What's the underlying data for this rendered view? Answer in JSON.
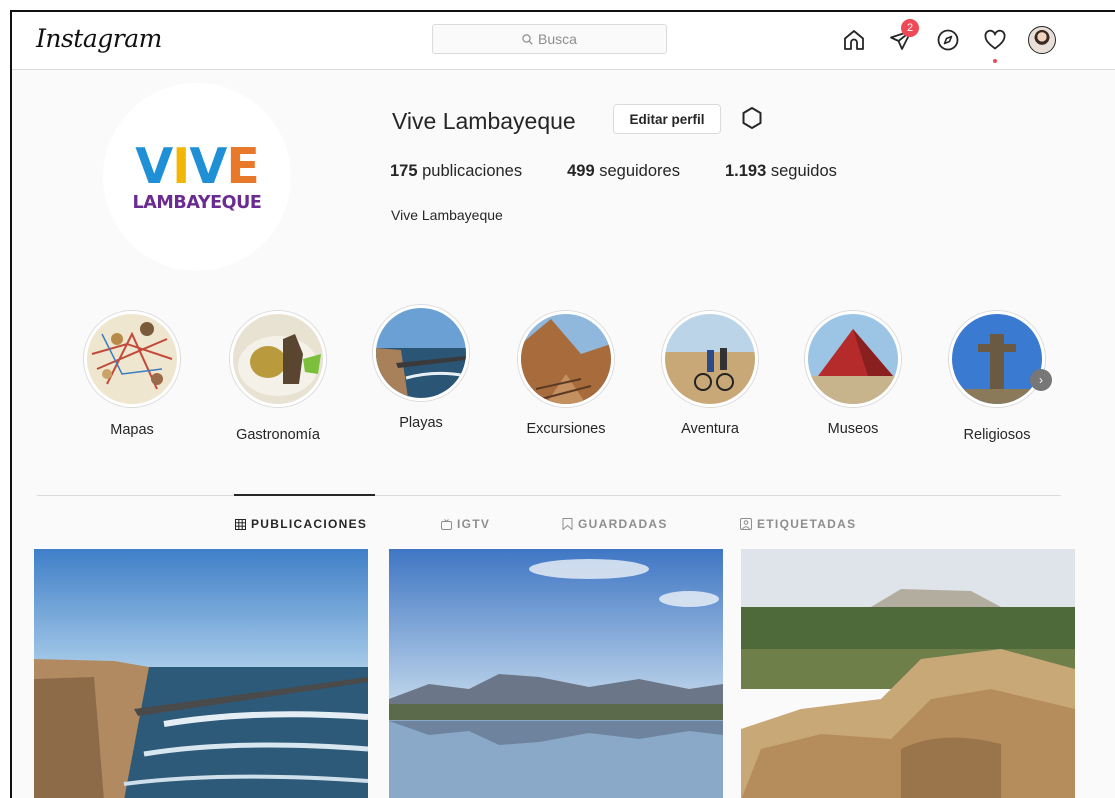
{
  "nav": {
    "logo": "Instagram",
    "search_placeholder": "Busca",
    "direct_badge": "2",
    "icons": [
      "home-icon",
      "direct-icon",
      "explore-icon",
      "activity-heart-icon",
      "profile-avatar"
    ]
  },
  "profile": {
    "username": "Vive Lambayeque",
    "edit_button": "Editar perfil",
    "logo_letters": [
      "V",
      "I",
      "V",
      "E"
    ],
    "logo_colors": [
      "#1f8fd6",
      "#f2b705",
      "#1f8fd6",
      "#e8782a"
    ],
    "logo_subtitle": "LAMBAYEQUE",
    "stats": [
      {
        "value": "175",
        "label": "publicaciones"
      },
      {
        "value": "499",
        "label": "seguidores"
      },
      {
        "value": "1.193",
        "label": "seguidos"
      }
    ],
    "full_name": "Vive Lambayeque"
  },
  "highlights": [
    {
      "label": "Mapas"
    },
    {
      "label": "Gastronomía"
    },
    {
      "label": "Playas"
    },
    {
      "label": "Excursiones"
    },
    {
      "label": "Aventura"
    },
    {
      "label": "Museos"
    },
    {
      "label": "Religiosos"
    }
  ],
  "tabs": [
    {
      "label": "PUBLICACIONES",
      "active": true
    },
    {
      "label": "IGTV",
      "active": false
    },
    {
      "label": "GUARDADAS",
      "active": false
    },
    {
      "label": "ETIQUETADAS",
      "active": false
    }
  ],
  "colors": {
    "accent_badge": "#ed4956",
    "border": "#dbdbdb",
    "muted_text": "#8e8e8e",
    "logo_purple": "#6a2c91"
  }
}
